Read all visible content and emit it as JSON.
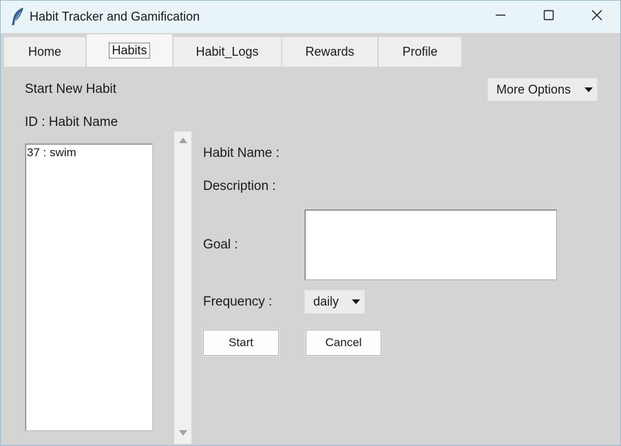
{
  "window": {
    "title": "Habit Tracker and Gamification",
    "icon": "feather-icon",
    "controls": {
      "minimize": "minimize-icon",
      "maximize": "maximize-icon",
      "close": "close-icon"
    }
  },
  "tabs": [
    {
      "label": "Home",
      "active": false
    },
    {
      "label": "Habits",
      "active": true
    },
    {
      "label": "Habit_Logs",
      "active": false
    },
    {
      "label": "Rewards",
      "active": false
    },
    {
      "label": "Profile",
      "active": false
    }
  ],
  "habits_page": {
    "section_title": "Start New Habit",
    "more_options": {
      "selected": "More Options"
    },
    "list_header": "ID : Habit Name",
    "list_items": [
      "37 : swim"
    ],
    "form": {
      "habit_name_label": "Habit Name :",
      "description_label": "Description :",
      "goal_label": "Goal :",
      "goal_value": "",
      "frequency_label": "Frequency :",
      "frequency_selected": "daily",
      "start_label": "Start",
      "cancel_label": "Cancel"
    }
  },
  "colors": {
    "background": "#d4d4d4",
    "titlebar": "#e8f4f8",
    "field": "#ffffff"
  }
}
